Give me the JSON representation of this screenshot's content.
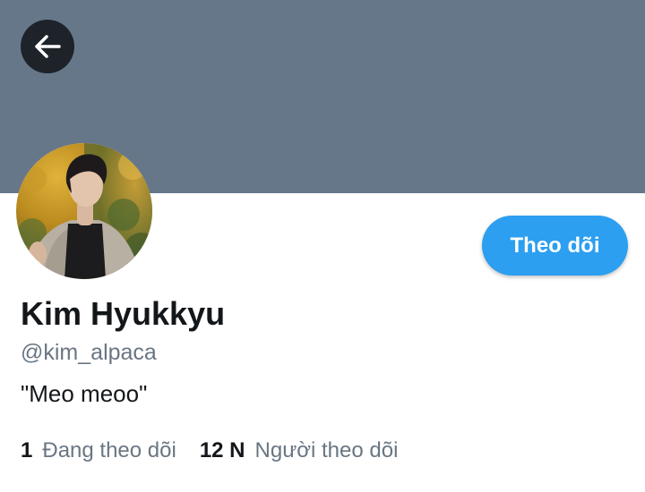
{
  "header": {
    "back_icon": "arrow-left-icon",
    "banner_color": "#66778a"
  },
  "profile": {
    "display_name": "Kim Hyukkyu",
    "handle": "@kim_alpaca",
    "bio": "\"Meo meoo\"",
    "follow_label": "Theo dõi",
    "accent_color": "#2c9ff0"
  },
  "stats": {
    "following_count": "1",
    "following_label": "Đang theo dõi",
    "followers_count": "12 N",
    "followers_label": "Người theo dõi"
  }
}
